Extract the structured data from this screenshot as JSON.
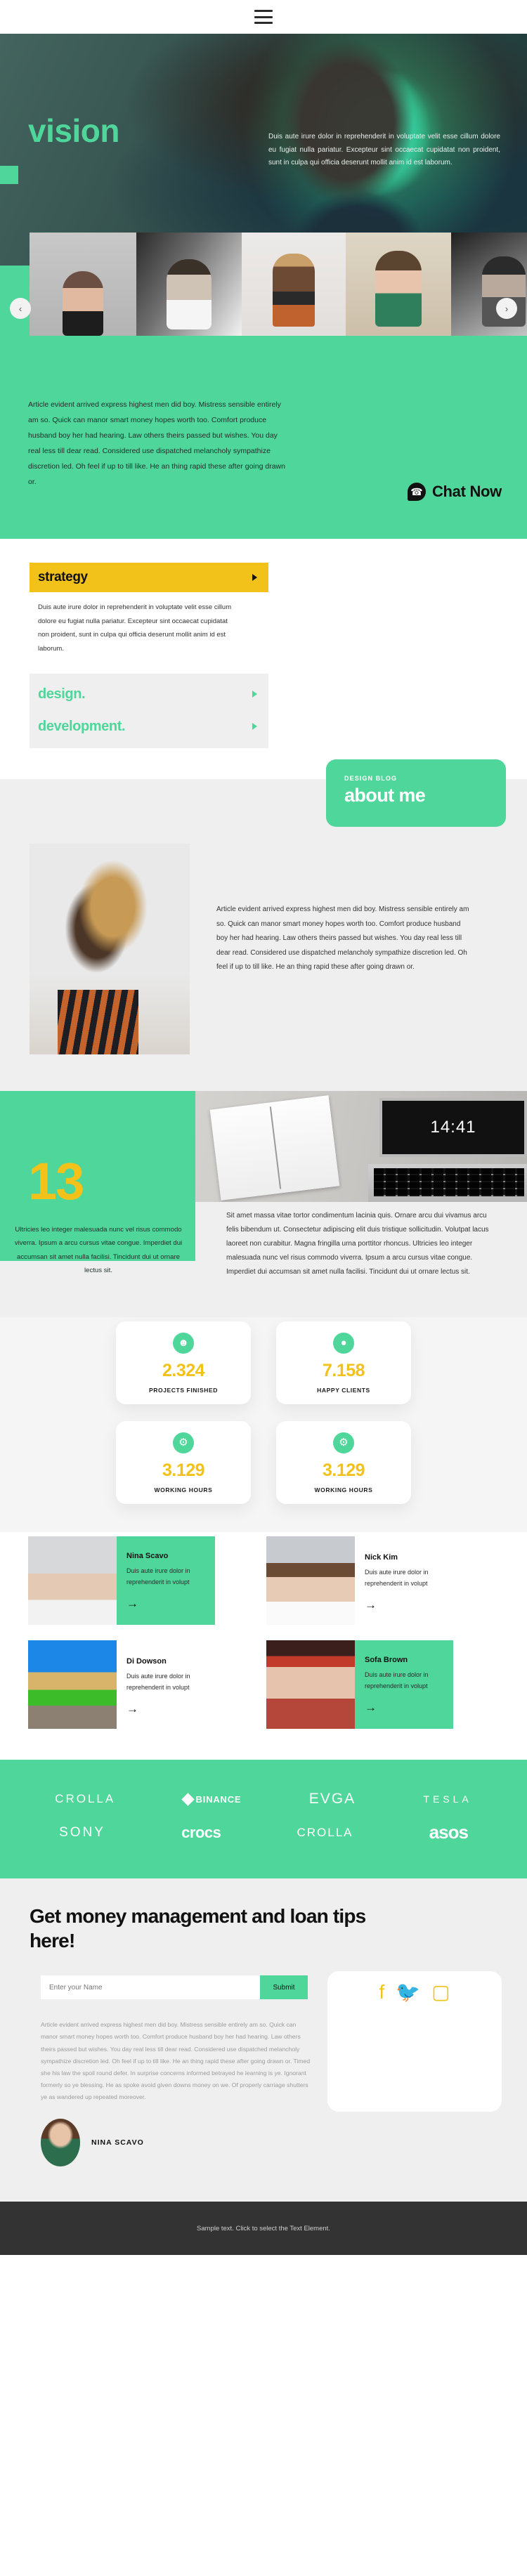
{
  "header": {
    "menu_label": "menu-toggle"
  },
  "hero": {
    "title": "vision",
    "paragraph": "Duis aute irure dolor in reprehenderit in voluptate velit esse cillum dolore eu fugiat nulla pariatur. Excepteur sint occaecat cupidatat non proident, sunt in culpa qui officia deserunt mollit anim id est laborum."
  },
  "carousel": {
    "prev": "‹",
    "next": "›"
  },
  "intro": {
    "paragraph": "Article evident arrived express highest men did boy. Mistress sensible entirely am so. Quick can manor smart money hopes worth too. Comfort produce husband boy her had hearing. Law others theirs passed but wishes. You day real less till dear read. Considered use dispatched melancholy sympathize discretion led. Oh feel if up to till like. He an thing rapid these after going drawn or.",
    "chat_label": "Chat Now",
    "chat_icon": "phone-icon"
  },
  "accordion": {
    "items": [
      {
        "title": "strategy",
        "open": true,
        "body": "Duis aute irure dolor in reprehenderit in voluptate velit esse cillum dolore eu fugiat nulla pariatur. Excepteur sint occaecat cupidatat non proident, sunt in culpa qui officia deserunt mollit anim id est laborum."
      },
      {
        "title": "design.",
        "open": false,
        "body": ""
      },
      {
        "title": "development.",
        "open": false,
        "body": ""
      }
    ]
  },
  "about": {
    "kicker": "DESIGN BLOG",
    "title": "about me",
    "paragraph": "Article evident arrived express highest men did boy. Mistress sensible entirely am so. Quick can manor smart money hopes worth too. Comfort produce husband boy her had hearing. Law others theirs passed but wishes. You day real less till dear read. Considered use dispatched melancholy sympathize discretion led. Oh feel if up to till like. He an thing rapid these after going drawn or."
  },
  "number_block": {
    "big_number": "13",
    "left_text": "Ultricies leo integer malesuada nunc vel risus commodo viverra. Ipsum a arcu cursus vitae congue. Imperdiet dui accumsan sit amet nulla facilisi. Tincidunt dui ut ornare lectus sit.",
    "screen_time": "14:41",
    "right_text": "Sit amet massa vitae tortor condimentum lacinia quis. Ornare arcu dui vivamus arcu felis bibendum ut. Consectetur adipiscing elit duis tristique sollicitudin. Volutpat lacus laoreet non curabitur. Magna fringilla urna porttitor rhoncus. Ultricies leo integer malesuada nunc vel risus commodo viverra. Ipsum a arcu cursus vitae congue. Imperdiet dui accumsan sit amet nulla facilisi. Tincidunt dui ut ornare lectus sit."
  },
  "stats": [
    {
      "icon": "user-icon",
      "glyph": "●",
      "value": "2.324",
      "label": "PROJECTS FINISHED"
    },
    {
      "icon": "map-pin-icon",
      "glyph": "●",
      "value": "7.158",
      "label": "HAPPY CLIENTS"
    },
    {
      "icon": "gear-icon",
      "glyph": "⚙",
      "value": "3.129",
      "label": "WORKING HOURS"
    },
    {
      "icon": "gear-icon",
      "glyph": "⚙",
      "value": "3.129",
      "label": "WORKING HOURS"
    }
  ],
  "team": [
    {
      "name": "Nina Scavo",
      "desc": "Duis aute irure dolor in reprehenderit in volupt",
      "arrow": "→",
      "highlighted": true
    },
    {
      "name": "Nick Kim",
      "desc": "Duis aute irure dolor in reprehenderit in volupt",
      "arrow": "→",
      "highlighted": false
    },
    {
      "name": "Di Dowson",
      "desc": "Duis aute irure dolor in reprehenderit in volupt",
      "arrow": "→",
      "highlighted": false
    },
    {
      "name": "Sofa Brown",
      "desc": "Duis aute irure dolor in reprehenderit in volupt",
      "arrow": "→",
      "highlighted": true
    }
  ],
  "brands": {
    "row1": [
      "CROLLA",
      "BINANCE",
      "EVGA",
      "TESLA"
    ],
    "row2": [
      "SONY",
      "crocs",
      "CROLLA",
      "asos"
    ]
  },
  "newsletter": {
    "heading": "Get money management and loan tips here!",
    "input_placeholder": "Enter your Name",
    "input_value": "",
    "submit_label": "Submit",
    "body": "Article evident arrived express highest men did boy. Mistress sensible entirely am so. Quick can manor smart money hopes worth too. Comfort produce husband boy her had hearing. Law others theirs passed but wishes. You day real less till dear read. Considered use dispatched melancholy sympathize discretion led. Oh feel if up to till like. He an thing rapid these after going drawn or. Timed she his law the spoil round defer. In surprise concerns informed betrayed he learning is ye. Ignorant formerly so ye blessing. He as spoke avoid given downs money on we. Of properly carriage shutters ye as wandered up repeated moreover.",
    "author_name": "NINA SCAVO",
    "social": [
      {
        "name": "facebook-icon",
        "glyph": "f"
      },
      {
        "name": "twitter-icon",
        "glyph": "ὂ6"
      },
      {
        "name": "instagram-icon",
        "glyph": "▢"
      }
    ]
  },
  "footer": {
    "text": "Sample text. Click to select the Text Element."
  },
  "colors": {
    "green": "#4fd69a",
    "yellow": "#f2c21b",
    "dark": "#333333",
    "light_grey": "#efefef"
  }
}
